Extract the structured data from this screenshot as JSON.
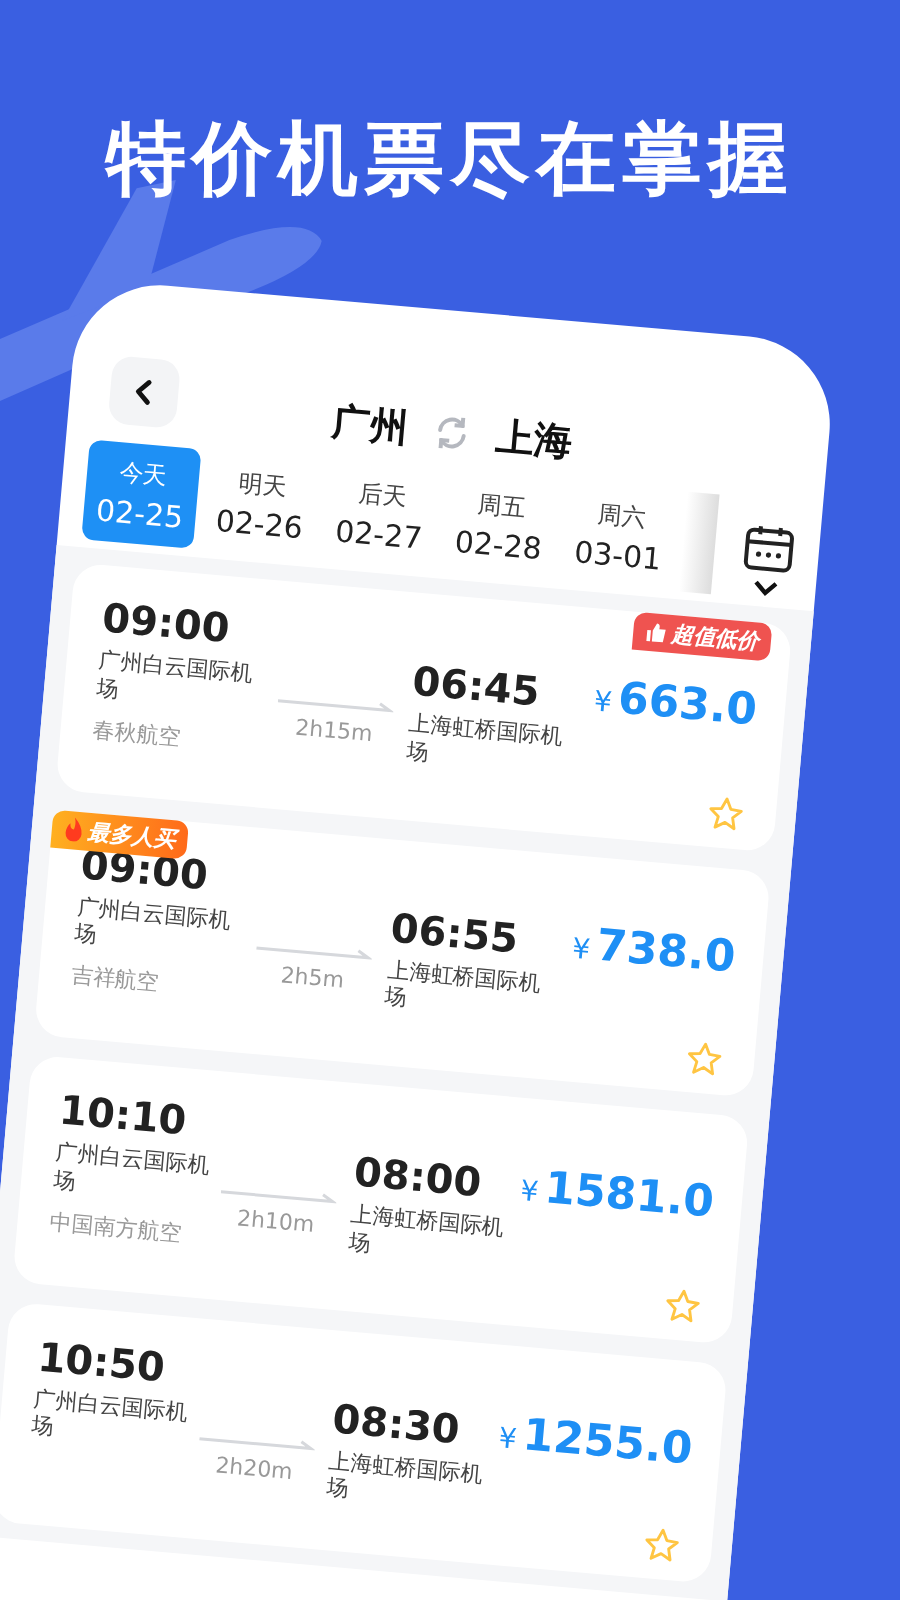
{
  "headline": "特价机票尽在掌握",
  "route": {
    "from": "广州",
    "to": "上海"
  },
  "dates": [
    {
      "day": "今天",
      "date": "02-25",
      "selected": true
    },
    {
      "day": "明天",
      "date": "02-26",
      "selected": false
    },
    {
      "day": "后天",
      "date": "02-27",
      "selected": false
    },
    {
      "day": "周五",
      "date": "02-28",
      "selected": false
    },
    {
      "day": "周六",
      "date": "03-01",
      "selected": false
    }
  ],
  "flights": [
    {
      "depart_time": "09:00",
      "depart_airport": "广州白云国际机场",
      "duration": "2h15m",
      "arrive_time": "06:45",
      "arrive_airport": "上海虹桥国际机场",
      "airline": "春秋航空",
      "currency": "¥",
      "price": "663.0",
      "favorite": false,
      "badge": {
        "kind": "deal",
        "text": "超值低价"
      }
    },
    {
      "depart_time": "09:00",
      "depart_airport": "广州白云国际机场",
      "duration": "2h5m",
      "arrive_time": "06:55",
      "arrive_airport": "上海虹桥国际机场",
      "airline": "吉祥航空",
      "currency": "¥",
      "price": "738.0",
      "favorite": false,
      "badge": {
        "kind": "popular",
        "text": "最多人买"
      }
    },
    {
      "depart_time": "10:10",
      "depart_airport": "广州白云国际机场",
      "duration": "2h10m",
      "arrive_time": "08:00",
      "arrive_airport": "上海虹桥国际机场",
      "airline": "中国南方航空",
      "currency": "¥",
      "price": "1581.0",
      "favorite": false
    },
    {
      "depart_time": "10:50",
      "depart_airport": "广州白云国际机场",
      "duration": "2h20m",
      "arrive_time": "08:30",
      "arrive_airport": "上海虹桥国际机场",
      "currency": "¥",
      "price": "1255.0",
      "favorite": false
    }
  ]
}
